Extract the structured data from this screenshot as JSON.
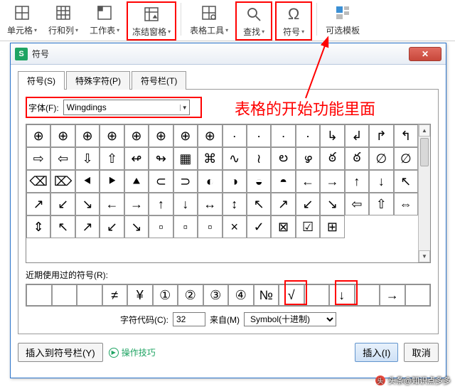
{
  "ribbon": {
    "cells": "单元格",
    "rowscols": "行和列",
    "worksheet": "工作表",
    "freeze": "冻结窗格",
    "tabletools": "表格工具",
    "find": "查找",
    "symbol": "符号",
    "template": "可选模板"
  },
  "dialog": {
    "title": "符号",
    "tabs": {
      "symbol": "符号(S)",
      "special": "特殊字符(P)",
      "bar": "符号栏(T)"
    },
    "font_label": "字体(F):",
    "font_value": "Wingdings",
    "recent_label": "近期使用过的符号(R):",
    "code_label": "字符代码(C):",
    "code_value": "32",
    "from_label": "来自(M)",
    "from_value": "Symbol(十进制)",
    "insert_bar": "插入到符号栏(Y)",
    "tips": "操作技巧",
    "insert": "插入(I)",
    "cancel": "取消"
  },
  "grid": [
    "⊕",
    "⊕",
    "⊕",
    "⊕",
    "⊕",
    "⊕",
    "⊕",
    "⊕",
    "·",
    "·",
    "·",
    "·",
    "↳",
    "↲",
    "↱",
    "↰",
    "⇨",
    "⇦",
    "⇩",
    "⇧",
    "↫",
    "↬",
    "▦",
    "⌘",
    "∿",
    "≀",
    "ల",
    "ഴ",
    "ఠ",
    "ఠ",
    "∅",
    "∅",
    "⌫",
    "⌦",
    "⯇",
    "⯈",
    "⯅",
    "⊂",
    "⊃",
    "◐",
    "◑",
    "◒",
    "◓",
    "←",
    "→",
    "↑",
    "↓",
    "↖",
    "↗",
    "↙",
    "↘",
    "←",
    "→",
    "↑",
    "↓",
    "↔",
    "↕",
    "↖",
    "↗",
    "↙",
    "↘",
    "⇦",
    "⇧",
    "⇔",
    "⇕",
    "↖",
    "↗",
    "↙",
    "↘",
    "▫",
    "▫",
    "▫",
    "×",
    "✓",
    "⊠",
    "☑",
    "⊞"
  ],
  "recent": [
    "",
    "",
    "",
    "≠",
    "¥",
    "①",
    "②",
    "③",
    "④",
    "№",
    "√",
    "",
    "↓",
    "",
    "→",
    ""
  ],
  "annotation": "表格的开始功能里面",
  "watermark": "头条@知识点多多"
}
